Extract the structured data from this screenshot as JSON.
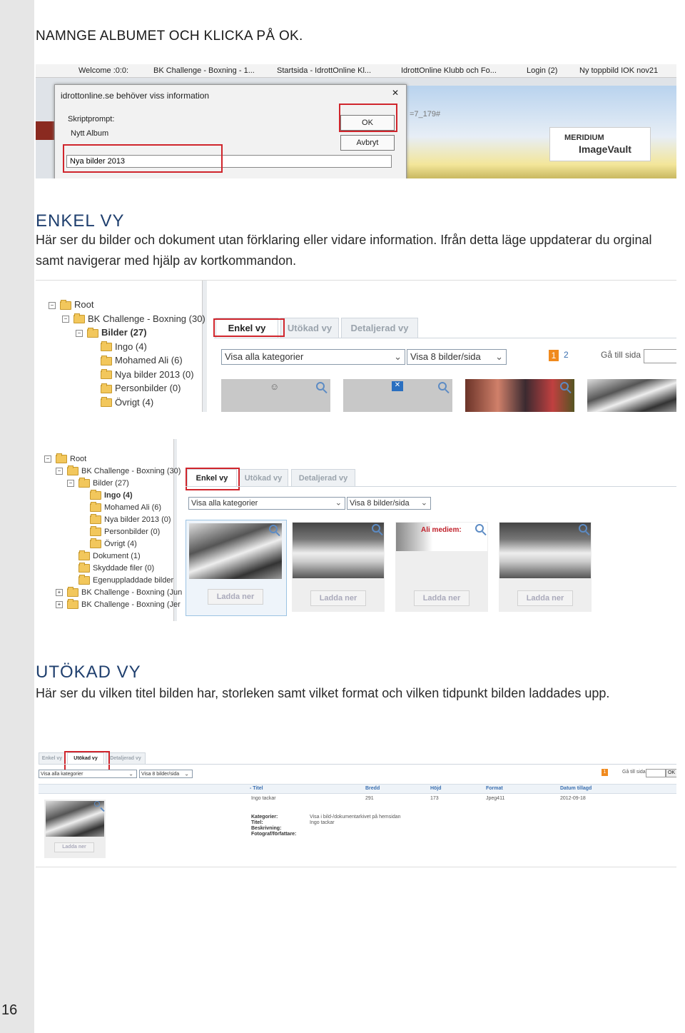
{
  "page_number": "16",
  "step_heading": "NAMNGE ALBUMET OCH KLICKA PÅ OK.",
  "dialog_shot": {
    "browser_tabs": [
      "Welcome :0:0:",
      "BK Challenge - Boxning - 1...",
      "Startsida - IdrottOnline Kl...",
      "IdrottOnline Klubb och Fo...",
      "Login (2)",
      "Ny toppbild IOK nov21"
    ],
    "dialog_title": "idrottonline.se behöver viss information",
    "prompt_line1": "Skriptprompt:",
    "prompt_line2": "Nytt Album",
    "input_value": "Nya bilder 2013",
    "ok_label": "OK",
    "cancel_label": "Avbryt",
    "bg_url_fragment": "=7_179#",
    "logo_line1": "MERIDIUM",
    "logo_line2": "ImageVault"
  },
  "enkel": {
    "heading": "ENKEL VY",
    "text": "Här ser du bilder och dokument utan förklaring eller vidare information. Ifrån detta läge uppdaterar du orginal samt navigerar med hjälp av kortkommandon."
  },
  "shot2": {
    "tree": [
      {
        "sign": "−",
        "label": "Root",
        "bold": false,
        "indent": 0
      },
      {
        "sign": "−",
        "label": "BK Challenge - Boxning (30)",
        "bold": false,
        "indent": 1
      },
      {
        "sign": "−",
        "label": "Bilder (27)",
        "bold": true,
        "indent": 2
      },
      {
        "sign": "",
        "label": "Ingo (4)",
        "bold": false,
        "indent": 3
      },
      {
        "sign": "",
        "label": "Mohamed Ali (6)",
        "bold": false,
        "indent": 3
      },
      {
        "sign": "",
        "label": "Nya bilder 2013 (0)",
        "bold": false,
        "indent": 3
      },
      {
        "sign": "",
        "label": "Personbilder (0)",
        "bold": false,
        "indent": 3
      },
      {
        "sign": "",
        "label": "Övrigt (4)",
        "bold": false,
        "indent": 3
      }
    ],
    "tabs": [
      "Enkel vy",
      "Utökad vy",
      "Detaljerad vy"
    ],
    "category_select": "Visa alla kategorier",
    "per_page_select": "Visa 8 bilder/sida",
    "pages": [
      "1",
      "2"
    ],
    "goto_label": "Gå till sida"
  },
  "shot3": {
    "tree": [
      {
        "sign": "−",
        "label": "Root",
        "bold": false,
        "indent": 0
      },
      {
        "sign": "−",
        "label": "BK Challenge - Boxning (30)",
        "bold": false,
        "indent": 1
      },
      {
        "sign": "−",
        "label": "Bilder (27)",
        "bold": false,
        "indent": 2
      },
      {
        "sign": "",
        "label": "Ingo (4)",
        "bold": true,
        "indent": 3
      },
      {
        "sign": "",
        "label": "Mohamed Ali (6)",
        "bold": false,
        "indent": 3
      },
      {
        "sign": "",
        "label": "Nya bilder 2013 (0)",
        "bold": false,
        "indent": 3
      },
      {
        "sign": "",
        "label": "Personbilder (0)",
        "bold": false,
        "indent": 3
      },
      {
        "sign": "",
        "label": "Övrigt (4)",
        "bold": false,
        "indent": 3
      },
      {
        "sign": "",
        "label": "Dokument (1)",
        "bold": false,
        "indent": 2
      },
      {
        "sign": "",
        "label": "Skyddade filer (0)",
        "bold": false,
        "indent": 2
      },
      {
        "sign": "",
        "label": "Egenuppladdade bilder",
        "bold": false,
        "indent": 2
      },
      {
        "sign": "+",
        "label": "BK Challenge - Boxning (Jun",
        "bold": false,
        "indent": 1
      },
      {
        "sign": "+",
        "label": "BK Challenge - Boxning (Jer",
        "bold": false,
        "indent": 1
      }
    ],
    "tabs": [
      "Enkel vy",
      "Utökad vy",
      "Detaljerad vy"
    ],
    "category_select": "Visa alla kategorier",
    "per_page_select": "Visa 8 bilder/sida",
    "thumb3_overlay": "Ali mediem:",
    "download_label": "Ladda ner"
  },
  "utokad": {
    "heading": "UTÖKAD VY",
    "text": "Här ser du vilken titel bilden har, storleken samt vilket format och vilken tidpunkt bilden laddades upp."
  },
  "shot4": {
    "tabs": [
      "Enkel vy",
      "Utökad vy",
      "Detaljerad vy"
    ],
    "category_select": "Visa alla kategorier",
    "per_page_select": "Visa 8 bilder/sida",
    "page": "1",
    "goto_label": "Gå till sida",
    "goto_ok": "OK",
    "columns": [
      "- Titel",
      "Bredd",
      "Höjd",
      "Format",
      "Datum tillagd"
    ],
    "row": [
      "Ingo tackar",
      "291",
      "173",
      "Jpeg411",
      "2012-09-18"
    ],
    "meta_labels": [
      "Kategorier:",
      "Titel:",
      "Beskrivning:",
      "Fotograf/författare:"
    ],
    "meta_value1": "Visa i bild-/dokumentarkivet på hemsidan",
    "meta_value2": "Ingo tackar",
    "download_label": "Ladda ner"
  }
}
